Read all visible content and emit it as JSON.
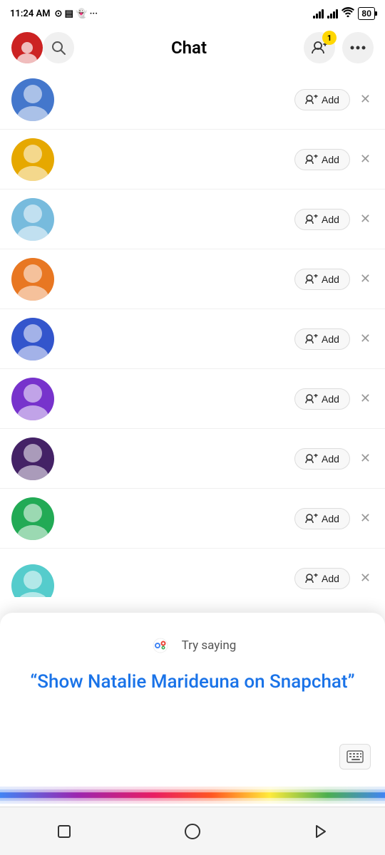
{
  "statusBar": {
    "time": "11:24 AM",
    "batteryLevel": "80"
  },
  "header": {
    "title": "Chat",
    "badgeCount": "1"
  },
  "chatItems": [
    {
      "id": 1,
      "avatarColor": "#4477cc",
      "avatarColorBody": "#3366bb"
    },
    {
      "id": 2,
      "avatarColor": "#e6a800",
      "avatarColorBody": "#cc9900"
    },
    {
      "id": 3,
      "avatarColor": "#77bbdd",
      "avatarColorBody": "#55aacc"
    },
    {
      "id": 4,
      "avatarColor": "#e87722",
      "avatarColorBody": "#d06610"
    },
    {
      "id": 5,
      "avatarColor": "#3355cc",
      "avatarColorBody": "#2244bb"
    },
    {
      "id": 6,
      "avatarColor": "#6633cc",
      "avatarColorBody": "#5522bb"
    },
    {
      "id": 7,
      "avatarColor": "#442266",
      "avatarColorBody": "#331155"
    },
    {
      "id": 8,
      "avatarColor": "#22aa55",
      "avatarColorBody": "#119944"
    }
  ],
  "addButtonLabel": "Add",
  "assistant": {
    "trySaying": "Try saying",
    "suggestion": "“Show Natalie Marideuna on Snapchat”"
  },
  "googleDots": {
    "blue": "#4285F4",
    "red": "#EA4335",
    "yellow": "#FBBC05",
    "green": "#34A853"
  }
}
